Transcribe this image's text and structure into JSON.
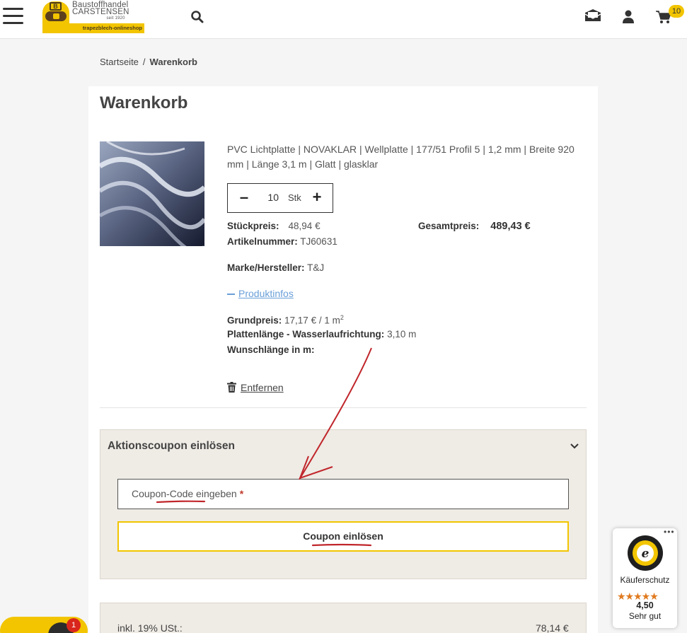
{
  "header": {
    "logo": {
      "line1": "Baustoffhandel",
      "line2": "CARSTENSEN",
      "since": "seit 1920",
      "tagline": "trapezblech-onlineshop"
    },
    "cart_count": "10",
    "icons": [
      "menu-icon",
      "search-icon",
      "mail-icon",
      "user-icon",
      "cart-icon"
    ]
  },
  "breadcrumb": {
    "home": "Startseite",
    "separator": "/",
    "current": "Warenkorb"
  },
  "page_title": "Warenkorb",
  "product": {
    "name": "PVC Lichtplatte | NOVAKLAR | Wellplatte | 177/51 Profil 5 | 1,2 mm | Breite 920 mm | Länge 3,1 m | Glatt | glasklar",
    "quantity": "10",
    "unit": "Stk",
    "unit_price_label": "Stückpreis:",
    "unit_price": "48,94 €",
    "total_label": "Gesamtpreis:",
    "total": "489,43 €",
    "article_label": "Artikelnummer:",
    "article_no": "TJ60631",
    "brand_label": "Marke/Hersteller:",
    "brand": "T&J",
    "info_link": "Produktinfos",
    "base_price_label": "Grundpreis:",
    "base_price": "17,17 € / 1 m",
    "base_price_sup": "2",
    "plate_length_label": "Plattenlänge - Wasserlaufrichtung:",
    "plate_length": "3,10 m",
    "desired_length_label": "Wunschlänge in m:",
    "remove_label": "Entfernen"
  },
  "coupon": {
    "title": "Aktionscoupon einlösen",
    "input_placeholder": "Coupon-Code eingeben",
    "required_mark": "*",
    "button_label": "Coupon einlösen"
  },
  "summary": {
    "vat_label": "inkl. 19% USt.:",
    "vat_value": "78,14 €"
  },
  "trusted_shops": {
    "label": "Käuferschutz",
    "stars": "★★★★★",
    "rating": "4,50",
    "rating_text": "Sehr gut",
    "menu": "•••"
  },
  "chat": {
    "badge": "1"
  },
  "colors": {
    "accent": "#f2c500",
    "link": "#6a9fd8",
    "annotation": "#c0262b",
    "coupon_bg": "#efebe5"
  }
}
